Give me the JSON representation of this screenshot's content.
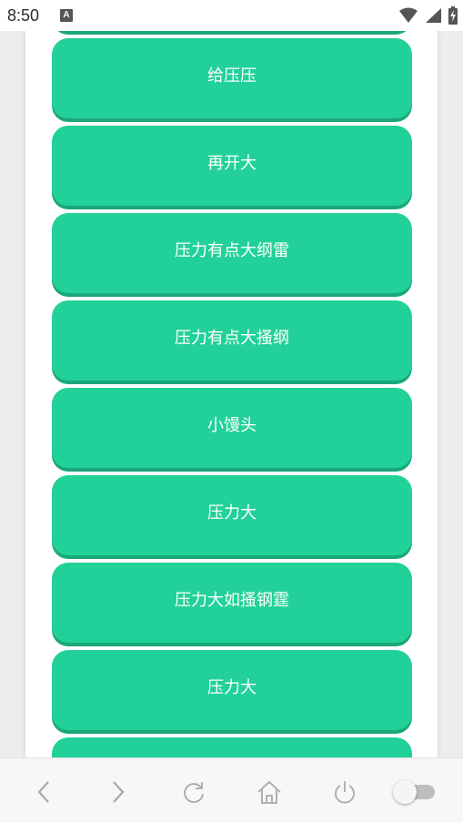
{
  "status_bar": {
    "time": "8:50",
    "notification_icon": "A",
    "icons": [
      "wifi-icon",
      "signal-icon",
      "battery-icon"
    ]
  },
  "list": {
    "items": [
      {
        "label": ""
      },
      {
        "label": "给压压"
      },
      {
        "label": "再开大"
      },
      {
        "label": "压力有点大纲雷"
      },
      {
        "label": "压力有点大搔纲"
      },
      {
        "label": "小馒头"
      },
      {
        "label": "压力大"
      },
      {
        "label": "压力大如搔钢霆"
      },
      {
        "label": "压力大"
      },
      {
        "label": ""
      }
    ]
  },
  "bottom_nav": {
    "icons": [
      "back-icon",
      "forward-icon",
      "refresh-icon",
      "home-icon",
      "power-icon",
      "toggle-switch"
    ],
    "toggle_on": false
  },
  "colors": {
    "button": "#22d199",
    "button_shadow": "#1aa87a",
    "background": "#eceeed"
  }
}
